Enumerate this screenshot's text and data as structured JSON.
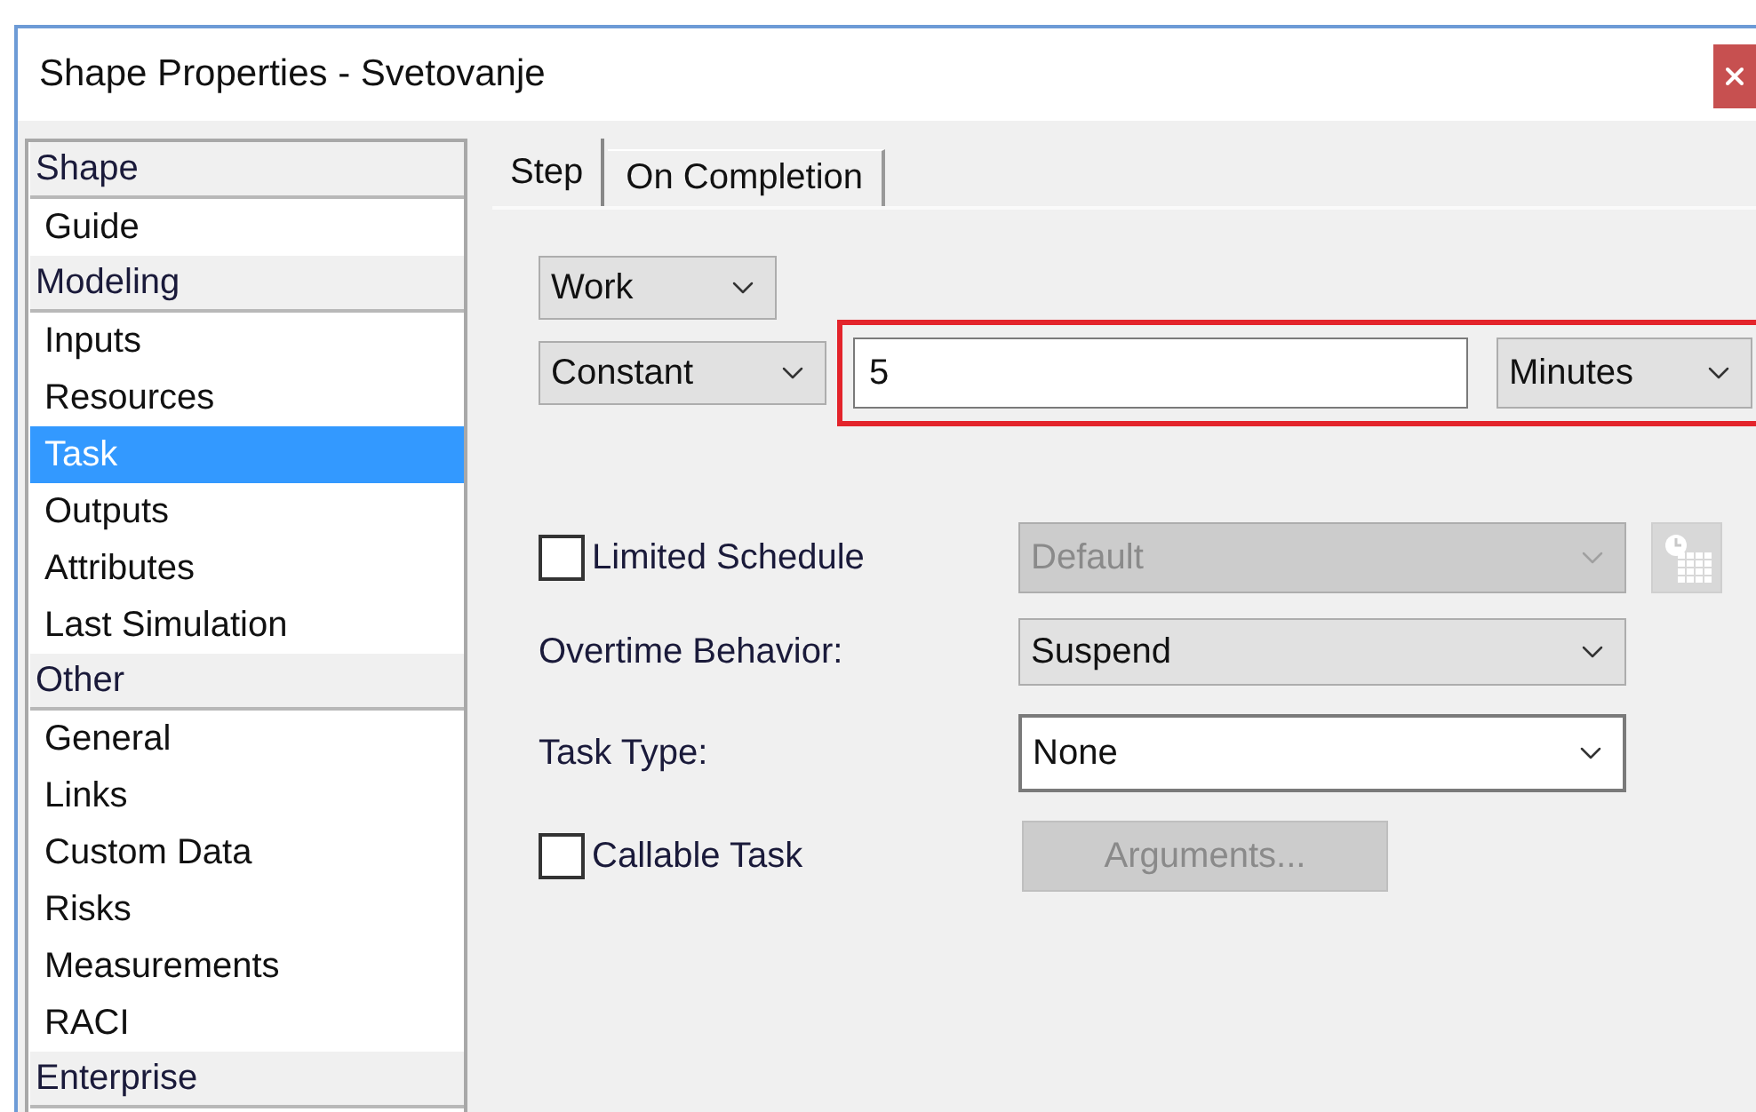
{
  "window": {
    "title": "Shape Properties - Svetovanje"
  },
  "sidebar": {
    "items": [
      {
        "label": "Shape",
        "kind": "header",
        "selected": false
      },
      {
        "label": "Guide",
        "kind": "item",
        "selected": false
      },
      {
        "label": "Modeling",
        "kind": "header",
        "selected": false
      },
      {
        "label": "Inputs",
        "kind": "item",
        "selected": false
      },
      {
        "label": "Resources",
        "kind": "item",
        "selected": false
      },
      {
        "label": "Task",
        "kind": "item",
        "selected": true
      },
      {
        "label": "Outputs",
        "kind": "item",
        "selected": false
      },
      {
        "label": "Attributes",
        "kind": "item",
        "selected": false
      },
      {
        "label": "Last Simulation",
        "kind": "item",
        "selected": false
      },
      {
        "label": "Other",
        "kind": "header",
        "selected": false
      },
      {
        "label": "General",
        "kind": "item",
        "selected": false
      },
      {
        "label": "Links",
        "kind": "item",
        "selected": false
      },
      {
        "label": "Custom Data",
        "kind": "item",
        "selected": false
      },
      {
        "label": "Risks",
        "kind": "item",
        "selected": false
      },
      {
        "label": "Measurements",
        "kind": "item",
        "selected": false
      },
      {
        "label": "RACI",
        "kind": "item",
        "selected": false
      },
      {
        "label": "Enterprise",
        "kind": "header",
        "selected": false
      }
    ]
  },
  "tabs": [
    {
      "label": "Step",
      "selected": true
    },
    {
      "label": "On Completion",
      "selected": false
    }
  ],
  "step": {
    "type": "Work",
    "duration": {
      "distribution": "Constant",
      "value": "5",
      "unit": "Minutes",
      "highlighted": true
    },
    "limited_schedule": {
      "label": "Limited Schedule",
      "checked": false,
      "schedule": "Default",
      "disabled": true
    },
    "overtime": {
      "label": "Overtime Behavior:",
      "value": "Suspend"
    },
    "task_type": {
      "label": "Task Type:",
      "value": "None"
    },
    "callable": {
      "label": "Callable Task",
      "checked": false,
      "button": "Arguments...",
      "disabled": true
    }
  }
}
